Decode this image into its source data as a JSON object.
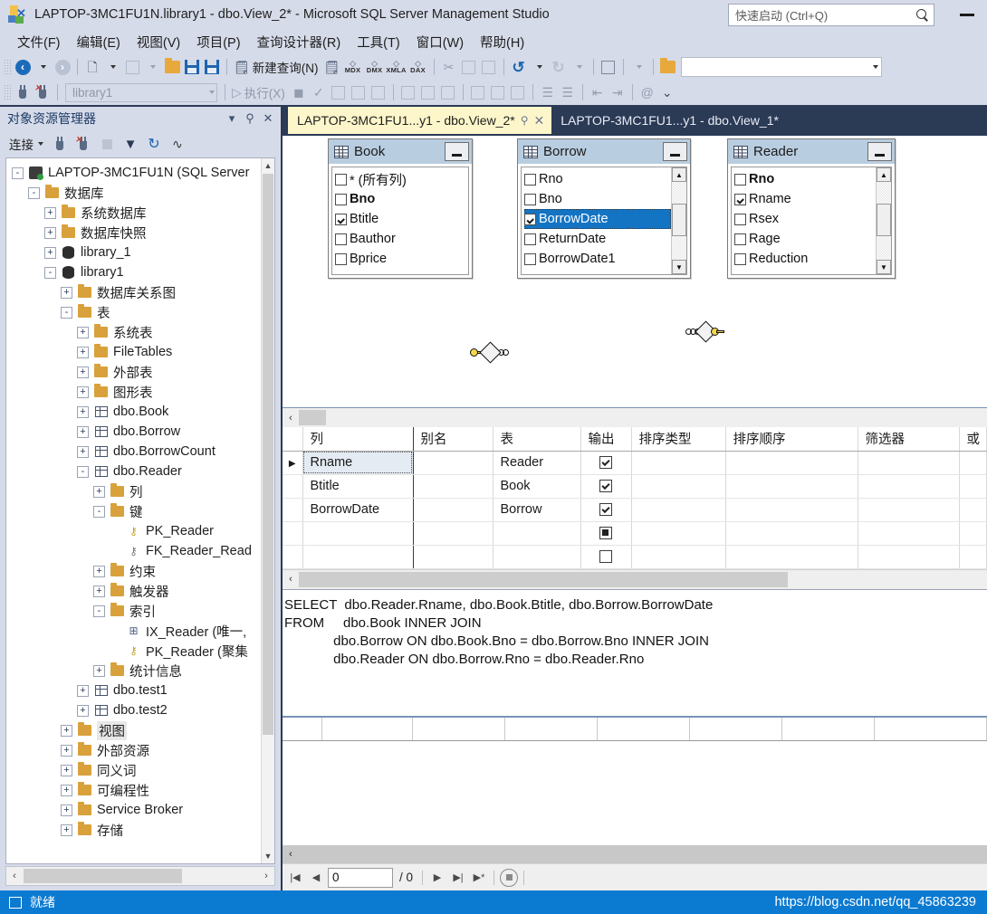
{
  "window": {
    "title": "LAPTOP-3MC1FU1N.library1 - dbo.View_2* - Microsoft SQL Server Management Studio",
    "quick_launch_placeholder": "快速启动 (Ctrl+Q)",
    "minimize_label": "—"
  },
  "menubar": {
    "items": [
      {
        "label": "文件(F)"
      },
      {
        "label": "编辑(E)"
      },
      {
        "label": "视图(V)"
      },
      {
        "label": "项目(P)"
      },
      {
        "label": "查询设计器(R)"
      },
      {
        "label": "工具(T)"
      },
      {
        "label": "窗口(W)"
      },
      {
        "label": "帮助(H)"
      }
    ]
  },
  "toolbar": {
    "new_query_label": "新建查询(N)",
    "mdx_label": "MDX",
    "dmx_label": "DMX",
    "xmla_label": "XMLA",
    "dax_label": "DAX",
    "database_value": "library1",
    "execute_label": "执行(X)",
    "find_combo_value": ""
  },
  "object_explorer": {
    "title": "对象资源管理器",
    "connect_label": "连接",
    "tree": [
      {
        "depth": 0,
        "expander": "-",
        "icon": "server-icon",
        "label": "LAPTOP-3MC1FU1N (SQL Server"
      },
      {
        "depth": 1,
        "expander": "-",
        "icon": "folder-icon",
        "label": "数据库"
      },
      {
        "depth": 2,
        "expander": "+",
        "icon": "folder-icon",
        "label": "系统数据库"
      },
      {
        "depth": 2,
        "expander": "+",
        "icon": "folder-icon",
        "label": "数据库快照"
      },
      {
        "depth": 2,
        "expander": "+",
        "icon": "database-icon",
        "label": "library_1"
      },
      {
        "depth": 2,
        "expander": "-",
        "icon": "database-icon",
        "label": "library1"
      },
      {
        "depth": 3,
        "expander": "+",
        "icon": "folder-icon",
        "label": "数据库关系图"
      },
      {
        "depth": 3,
        "expander": "-",
        "icon": "folder-icon",
        "label": "表"
      },
      {
        "depth": 4,
        "expander": "+",
        "icon": "folder-icon",
        "label": "系统表"
      },
      {
        "depth": 4,
        "expander": "+",
        "icon": "folder-icon",
        "label": "FileTables"
      },
      {
        "depth": 4,
        "expander": "+",
        "icon": "folder-icon",
        "label": "外部表"
      },
      {
        "depth": 4,
        "expander": "+",
        "icon": "folder-icon",
        "label": "图形表"
      },
      {
        "depth": 4,
        "expander": "+",
        "icon": "table-icon",
        "label": "dbo.Book"
      },
      {
        "depth": 4,
        "expander": "+",
        "icon": "table-icon",
        "label": "dbo.Borrow"
      },
      {
        "depth": 4,
        "expander": "+",
        "icon": "table-icon",
        "label": "dbo.BorrowCount"
      },
      {
        "depth": 4,
        "expander": "-",
        "icon": "table-icon",
        "label": "dbo.Reader"
      },
      {
        "depth": 5,
        "expander": "+",
        "icon": "folder-icon",
        "label": "列"
      },
      {
        "depth": 5,
        "expander": "-",
        "icon": "folder-icon",
        "label": "键"
      },
      {
        "depth": 6,
        "expander": "",
        "icon": "primary-key-icon",
        "label": "PK_Reader"
      },
      {
        "depth": 6,
        "expander": "",
        "icon": "foreign-key-icon",
        "label": "FK_Reader_Read"
      },
      {
        "depth": 5,
        "expander": "+",
        "icon": "folder-icon",
        "label": "约束"
      },
      {
        "depth": 5,
        "expander": "+",
        "icon": "folder-icon",
        "label": "触发器"
      },
      {
        "depth": 5,
        "expander": "-",
        "icon": "folder-icon",
        "label": "索引"
      },
      {
        "depth": 6,
        "expander": "",
        "icon": "index-icon",
        "label": "IX_Reader (唯一,"
      },
      {
        "depth": 6,
        "expander": "",
        "icon": "primary-key-icon",
        "label": "PK_Reader (聚集"
      },
      {
        "depth": 5,
        "expander": "+",
        "icon": "folder-icon",
        "label": "统计信息"
      },
      {
        "depth": 4,
        "expander": "+",
        "icon": "table-icon",
        "label": "dbo.test1"
      },
      {
        "depth": 4,
        "expander": "+",
        "icon": "table-icon",
        "label": "dbo.test2"
      },
      {
        "depth": 3,
        "expander": "+",
        "icon": "folder-icon",
        "label": "视图",
        "selected": true
      },
      {
        "depth": 3,
        "expander": "+",
        "icon": "folder-icon",
        "label": "外部资源"
      },
      {
        "depth": 3,
        "expander": "+",
        "icon": "folder-icon",
        "label": "同义词"
      },
      {
        "depth": 3,
        "expander": "+",
        "icon": "folder-icon",
        "label": "可编程性"
      },
      {
        "depth": 3,
        "expander": "+",
        "icon": "folder-icon",
        "label": "Service Broker"
      },
      {
        "depth": 3,
        "expander": "+",
        "icon": "folder-icon",
        "label": "存储"
      }
    ]
  },
  "tabs": [
    {
      "label": "LAPTOP-3MC1FU1...y1 - dbo.View_2*",
      "active": true
    },
    {
      "label": "LAPTOP-3MC1FU1...y1 - dbo.View_1*",
      "active": false
    }
  ],
  "diagram": {
    "tables": [
      {
        "name": "Book",
        "columns": [
          {
            "label": "* (所有列)",
            "checked": false,
            "bold": false,
            "selected": false
          },
          {
            "label": "Bno",
            "checked": false,
            "bold": true,
            "selected": false
          },
          {
            "label": "Btitle",
            "checked": true,
            "bold": false,
            "selected": false
          },
          {
            "label": "Bauthor",
            "checked": false,
            "bold": false,
            "selected": false
          },
          {
            "label": "Bprice",
            "checked": false,
            "bold": false,
            "selected": false
          }
        ],
        "scrollbar": false
      },
      {
        "name": "Borrow",
        "columns": [
          {
            "label": "Rno",
            "checked": false,
            "bold": false,
            "selected": false
          },
          {
            "label": "Bno",
            "checked": false,
            "bold": false,
            "selected": false
          },
          {
            "label": "BorrowDate",
            "checked": true,
            "bold": false,
            "selected": true
          },
          {
            "label": "ReturnDate",
            "checked": false,
            "bold": false,
            "selected": false
          },
          {
            "label": "BorrowDate1",
            "checked": false,
            "bold": false,
            "selected": false
          }
        ],
        "scrollbar": true
      },
      {
        "name": "Reader",
        "columns": [
          {
            "label": "Rno",
            "checked": false,
            "bold": true,
            "selected": false
          },
          {
            "label": "Rname",
            "checked": true,
            "bold": false,
            "selected": false
          },
          {
            "label": "Rsex",
            "checked": false,
            "bold": false,
            "selected": false
          },
          {
            "label": "Rage",
            "checked": false,
            "bold": false,
            "selected": false
          },
          {
            "label": "Reduction",
            "checked": false,
            "bold": false,
            "selected": false
          }
        ],
        "scrollbar": true
      }
    ]
  },
  "grid": {
    "headers": [
      "列",
      "别名",
      "表",
      "输出",
      "排序类型",
      "排序顺序",
      "筛选器",
      "或"
    ],
    "rows": [
      {
        "marker": "▶",
        "col": "Rname",
        "alias": "",
        "table": "Reader",
        "output": "checked",
        "sort_type": "",
        "sort_order": "",
        "filter": "",
        "or": "",
        "selected": true
      },
      {
        "marker": "",
        "col": "Btitle",
        "alias": "",
        "table": "Book",
        "output": "checked",
        "sort_type": "",
        "sort_order": "",
        "filter": "",
        "or": "",
        "selected": false
      },
      {
        "marker": "",
        "col": "BorrowDate",
        "alias": "",
        "table": "Borrow",
        "output": "checked",
        "sort_type": "",
        "sort_order": "",
        "filter": "",
        "or": "",
        "selected": false
      },
      {
        "marker": "",
        "col": "",
        "alias": "",
        "table": "",
        "output": "filled",
        "sort_type": "",
        "sort_order": "",
        "filter": "",
        "or": "",
        "selected": false
      },
      {
        "marker": "",
        "col": "",
        "alias": "",
        "table": "",
        "output": "empty",
        "sort_type": "",
        "sort_order": "",
        "filter": "",
        "or": "",
        "selected": false
      }
    ]
  },
  "sql": {
    "text": "SELECT  dbo.Reader.Rname, dbo.Book.Btitle, dbo.Borrow.BorrowDate\nFROM     dbo.Book INNER JOIN\n             dbo.Borrow ON dbo.Book.Bno = dbo.Borrow.Bno INNER JOIN\n             dbo.Reader ON dbo.Borrow.Rno = dbo.Reader.Rno"
  },
  "results": {
    "nav_current": "0",
    "nav_total": "/ 0"
  },
  "statusbar": {
    "text": "就绪",
    "watermark": "https://blog.csdn.net/qq_45863239"
  },
  "colors": {
    "chrome": "#d6dbe9",
    "dark_frame": "#2b3a55",
    "active_tab": "#fdf6ca",
    "status_blue": "#0b7ad1",
    "selection_blue": "#1474c4",
    "table_header": "#b9cde0"
  }
}
